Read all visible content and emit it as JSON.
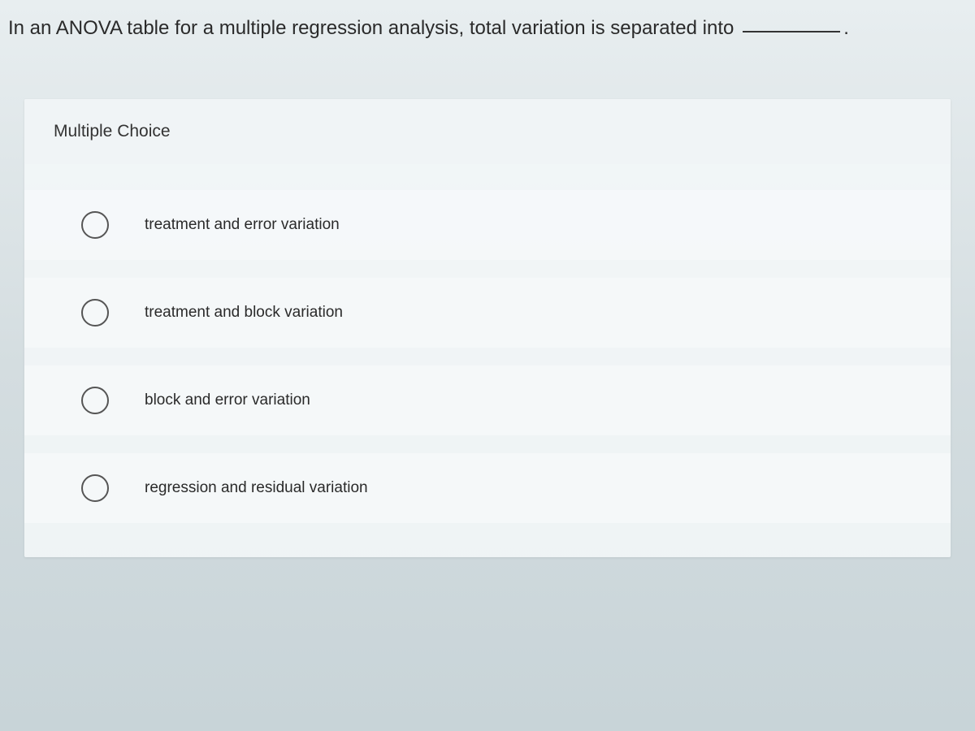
{
  "question": {
    "text": "In an ANOVA table for a multiple regression analysis, total variation is separated into"
  },
  "section_label": "Multiple Choice",
  "options": [
    {
      "label": "treatment and error variation"
    },
    {
      "label": "treatment and block variation"
    },
    {
      "label": "block and error variation"
    },
    {
      "label": "regression and residual variation"
    }
  ]
}
